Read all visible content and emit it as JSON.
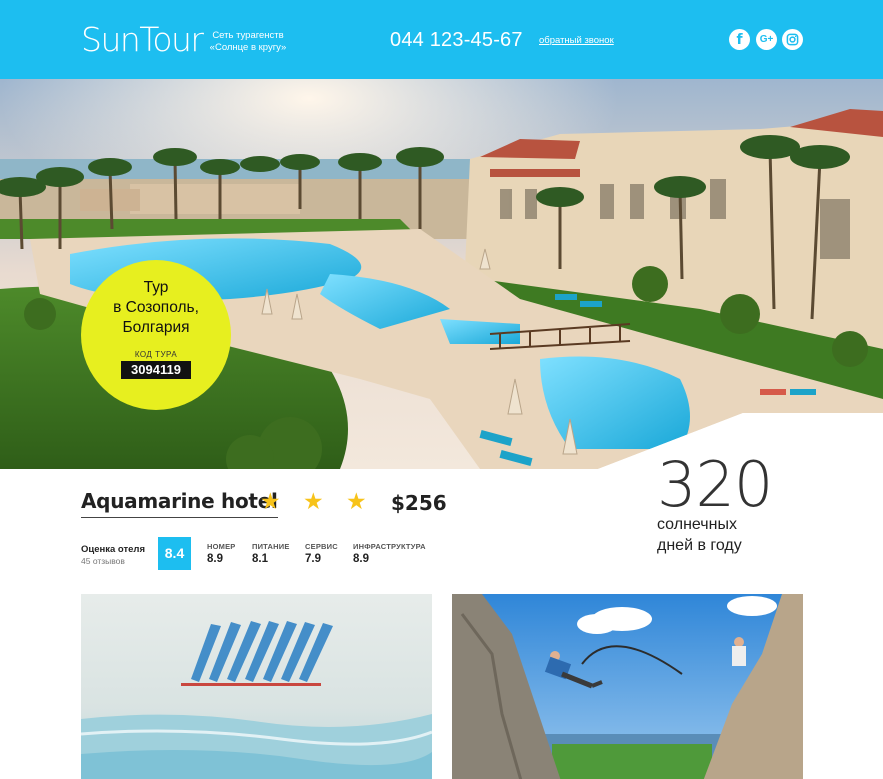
{
  "header": {
    "logo": "SunTour",
    "tagline": "Сеть турагенств «Солнце в кругу»",
    "phone": "044 123-45-67",
    "callback": "обратный звонок",
    "social": {
      "facebook": "f",
      "googleplus": "G+"
    }
  },
  "tour": {
    "title_line1": "Тур",
    "title_line2": "в Созополь,",
    "title_line3": "Болгария",
    "code_label": "КОД ТУРА",
    "code": "3094119"
  },
  "hotel": {
    "name": "Aquamarine hotel",
    "stars": 3,
    "price": "$256",
    "rating_label": "Оценка отеля",
    "reviews": "45 отзывов",
    "rating": "8.4",
    "metrics": [
      {
        "label": "НОМЕР",
        "value": "8.9"
      },
      {
        "label": "ПИТАНИЕ",
        "value": "8.1"
      },
      {
        "label": "СЕРВИС",
        "value": "7.9"
      },
      {
        "label": "ИНФРАСТРУКТУРА",
        "value": "8.9"
      }
    ]
  },
  "sunny": {
    "number": "320",
    "line1": "солнечных",
    "line2": "дней в году"
  },
  "colors": {
    "brand": "#1dbef0",
    "badge": "#e7ef1f",
    "star": "#f7c31a"
  }
}
